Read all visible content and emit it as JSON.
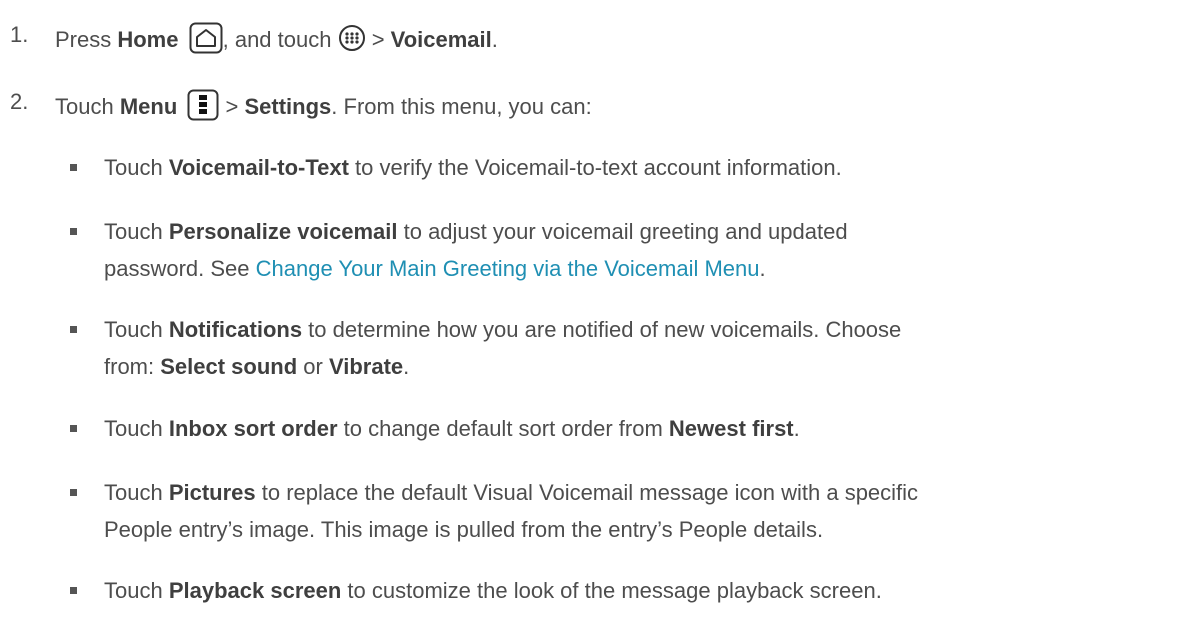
{
  "steps": [
    {
      "number": "1.",
      "p1": "Press ",
      "b1": "Home",
      "p2": ", and touch ",
      "icon_home": "home-icon",
      "icon_apps": "apps-icon",
      "p3": " > ",
      "b2": "Voicemail",
      "p4": "."
    },
    {
      "number": "2.",
      "p1": "Touch ",
      "b1": "Menu",
      "icon_menu": "menu-icon",
      "p2": " > ",
      "b2": "Settings",
      "p3": ". From this menu, you can:"
    }
  ],
  "bullets": [
    {
      "pre": "Touch ",
      "bold": "Voicemail-to-Text",
      "post": " to verify the Voicemail-to-text account information."
    },
    {
      "pre": "Touch ",
      "bold": "Personalize voicemail",
      "post": " to adjust your voicemail greeting and updated",
      "line2_pre": "password. See ",
      "link": "Change Your Main Greeting via the Voicemail Menu",
      "line2_post": "."
    },
    {
      "pre": "Touch ",
      "bold": "Notifications",
      "post": " to determine how you are notified of new voicemails. Choose",
      "line2_pre": "from: ",
      "bold2": "Select sound",
      "mid2": " or ",
      "bold3": "Vibrate",
      "line2_post": "."
    },
    {
      "pre": "Touch ",
      "bold": "Inbox sort order",
      "post": " to change default sort order from ",
      "bold2": "Newest first",
      "end": "."
    },
    {
      "pre": "Touch ",
      "bold": "Pictures",
      "post": " to replace the default Visual Voicemail message icon with a specific",
      "line2": "People entry’s image. This image is pulled from the entry’s People details."
    },
    {
      "pre": "Touch ",
      "bold": "Playback screen",
      "post": " to customize the look of the message playback screen."
    }
  ],
  "colors": {
    "text": "#4d4d4d",
    "bold": "#3f3f3f",
    "link": "#1f8fb3"
  }
}
